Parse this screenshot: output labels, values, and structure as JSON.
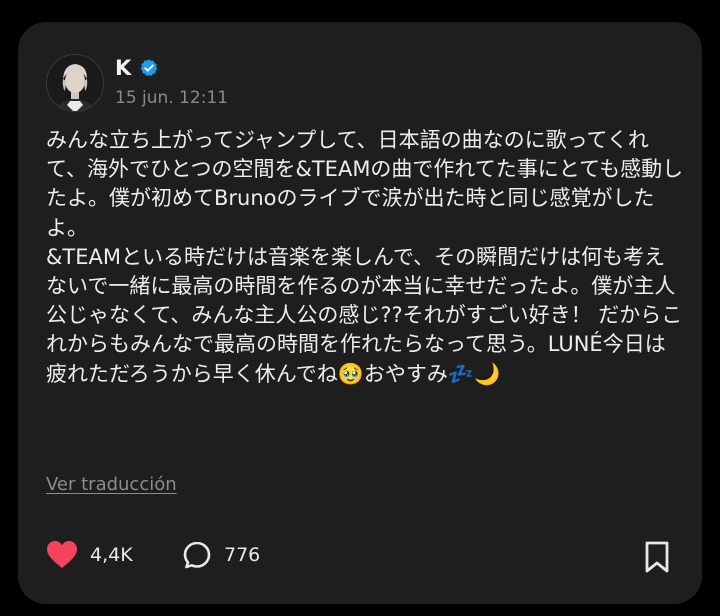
{
  "post": {
    "author": "K",
    "verified_icon": "verified-badge-icon",
    "timestamp": "15 jun. 12:11",
    "body": "みんな立ち上がってジャンプして、日本語の曲なのに歌ってくれて、海外でひとつの空間を&TEAMの曲で作れてた事にとても感動したよ。僕が初めてBrunoのライブで涙が出た時と同じ感覚がしたよ。\n&TEAMといる時だけは音楽を楽しんで、その瞬間だけは何も考えないで一緒に最高の時間を作るのが本当に幸せだったよ。僕が主人公じゃなくて、みんな主人公の感じ??それがすごい好き！ だからこれからもみんなで最高の時間を作れたらなって思う。LUNÉ今日は疲れただろうから早く休んでね🥹おやすみ💤🌙",
    "translate_label": "Ver traducción"
  },
  "actions": {
    "likes": "4,4K",
    "replies": "776"
  },
  "colors": {
    "background": "#000000",
    "card": "#1e1e1f",
    "heart": "#f4435b",
    "verified": "#1d9bf0",
    "text": "#ededed",
    "muted": "#8a8a8a"
  }
}
